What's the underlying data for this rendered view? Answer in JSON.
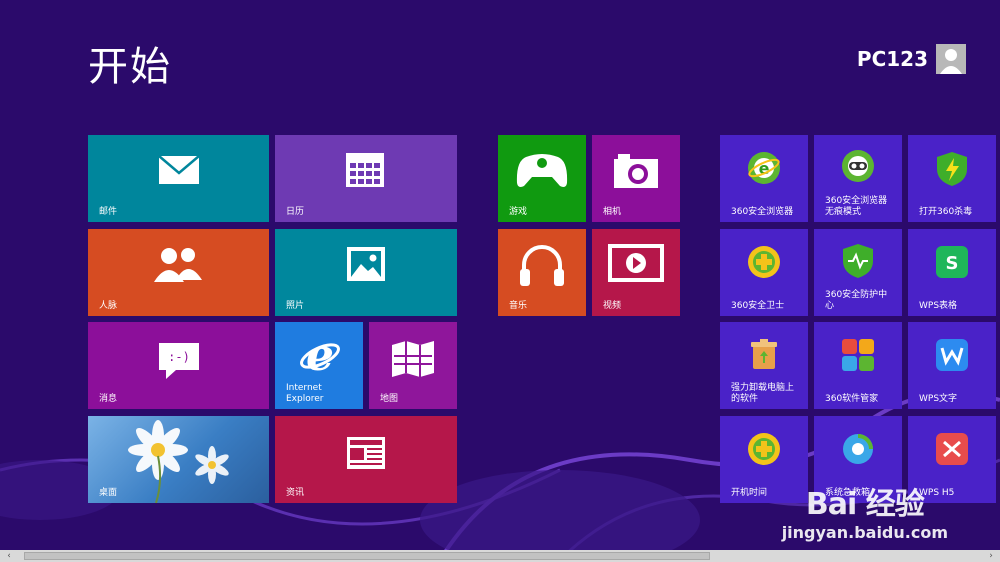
{
  "start": {
    "title": "开始"
  },
  "user": {
    "name": "PC123"
  },
  "tiles": [
    {
      "label": "邮件",
      "color": "#00869c",
      "icon": "mail-icon"
    },
    {
      "label": "日历",
      "color": "#6e3ab3",
      "icon": "calendar-icon"
    },
    {
      "label": "人脉",
      "color": "#d64c22",
      "icon": "people-icon"
    },
    {
      "label": "照片",
      "color": "#00879d",
      "icon": "photos-icon"
    },
    {
      "label": "消息",
      "color": "#8c0f9a",
      "icon": "messaging-icon"
    },
    {
      "label": "Internet Explorer",
      "color": "#1f7ce0",
      "icon": "internet-explorer-icon"
    },
    {
      "label": "地图",
      "color": "#8f169b",
      "icon": "maps-icon"
    },
    {
      "label": "桌面",
      "color": "#3a7ec4",
      "icon": "desktop-wallpaper"
    },
    {
      "label": "资讯",
      "color": "#b5174a",
      "icon": "news-icon"
    },
    {
      "label": "游戏",
      "color": "#109a10",
      "icon": "xbox-controller-icon"
    },
    {
      "label": "相机",
      "color": "#8c0f9a",
      "icon": "camera-icon"
    },
    {
      "label": "音乐",
      "color": "#d64c22",
      "icon": "headphones-icon"
    },
    {
      "label": "视频",
      "color": "#b5174a",
      "icon": "video-icon"
    },
    {
      "label": "360安全浏览器",
      "color": "#4a22c8",
      "icon": "360-browser-icon"
    },
    {
      "label": "360安全浏览器无痕模式",
      "color": "#4a22c8",
      "icon": "360-browser-incognito-icon"
    },
    {
      "label": "打开360杀毒",
      "color": "#4a22c8",
      "icon": "360-antivirus-icon"
    },
    {
      "label": "360安全卫士",
      "color": "#4a22c8",
      "icon": "360-security-guard-icon"
    },
    {
      "label": "360安全防护中心",
      "color": "#4a22c8",
      "icon": "360-protection-center-icon"
    },
    {
      "label": "WPS表格",
      "color": "#4a22c8",
      "icon": "wps-spreadsheet-icon"
    },
    {
      "label": "强力卸载电脑上的软件",
      "color": "#4a22c8",
      "icon": "uninstall-icon"
    },
    {
      "label": "360软件管家",
      "color": "#4a22c8",
      "icon": "360-software-manager-icon"
    },
    {
      "label": "WPS文字",
      "color": "#4a22c8",
      "icon": "wps-writer-icon"
    },
    {
      "label": "开机时间",
      "color": "#4a22c8",
      "icon": "360-boot-time-icon"
    },
    {
      "label": "系统急救箱",
      "color": "#4a22c8",
      "icon": "360-first-aid-icon"
    },
    {
      "label": "WPS H5",
      "color": "#4a22c8",
      "icon": "wps-h5-icon"
    }
  ],
  "watermark": {
    "logo": "Bai 经验",
    "url": "jingyan.baidu.com"
  },
  "scroll": {
    "left": "‹",
    "right": "›"
  }
}
